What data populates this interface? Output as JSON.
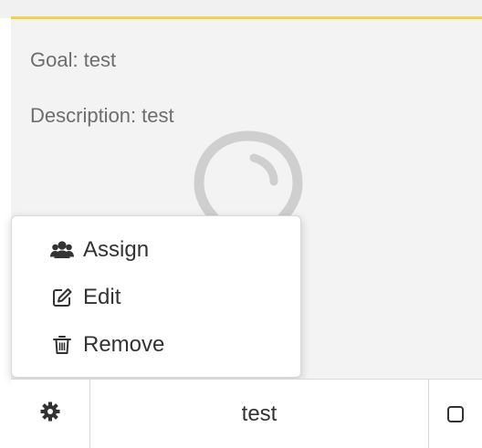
{
  "card": {
    "goal_label": "Goal:",
    "goal_value": "test",
    "description_label": "Description:",
    "description_value": "test",
    "accent_color": "#f2d24a",
    "icon": "lightbulb-icon"
  },
  "context_menu": {
    "items": [
      {
        "label": "Assign",
        "icon": "users-icon"
      },
      {
        "label": "Edit",
        "icon": "edit-icon"
      },
      {
        "label": "Remove",
        "icon": "trash-icon"
      }
    ]
  },
  "row": {
    "settings_icon": "gear-icon",
    "name": "test",
    "checkbox_checked": false
  }
}
